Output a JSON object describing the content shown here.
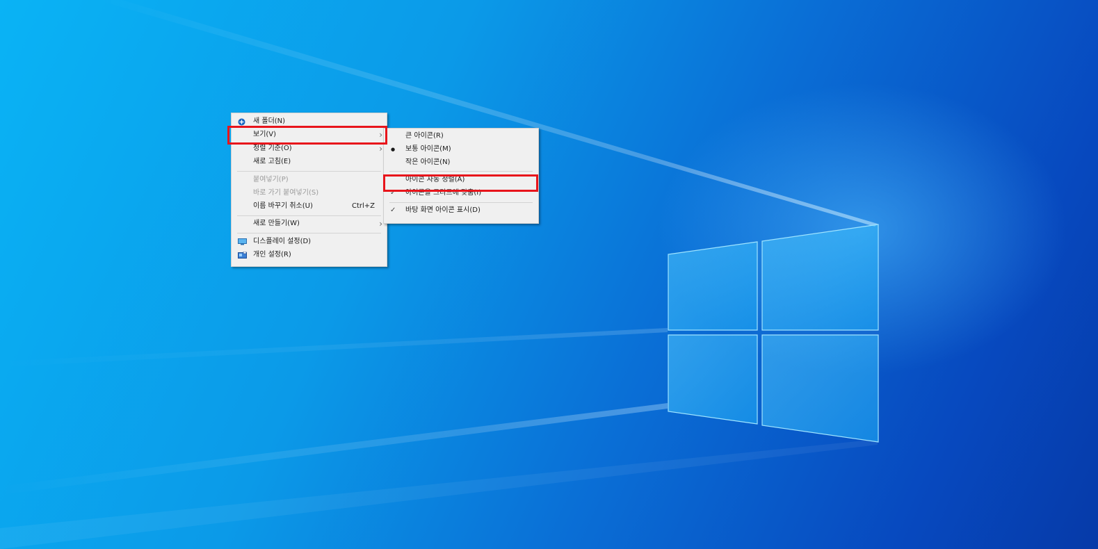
{
  "desktop": {
    "wallpaper": "Windows 10 hero wallpaper",
    "colors": {
      "highlight": "#e8141b",
      "menu_bg": "#f0f0f0",
      "accent_blue": "#0b9ae8"
    }
  },
  "context_menu": {
    "new_folder": "새 폴더(N)",
    "view": "보기(V)",
    "sort_by": "정렬 기준(O)",
    "refresh": "새로 고침(E)",
    "paste": "붙여넣기(P)",
    "paste_shortcut": "바로 가기 붙여넣기(S)",
    "undo_rename": "이름 바꾸기 취소(U)",
    "undo_rename_shortcut": "Ctrl+Z",
    "new": "새로 만들기(W)",
    "display_settings": "디스플레이 설정(D)",
    "personalize": "개인 설정(R)"
  },
  "view_submenu": {
    "large_icons": "큰 아이콘(R)",
    "medium_icons": "보통 아이콘(M)",
    "small_icons": "작은 아이콘(N)",
    "auto_arrange": "아이콘 자동 정렬(A)",
    "align_to_grid": "아이콘을 그리드에 맞춤(I)",
    "show_desktop_icons": "바탕 화면 아이콘 표시(D)",
    "bullet": "●",
    "check": "✓"
  },
  "icons": {
    "arrow": "›",
    "new_folder_icon": "plus-circle-icon",
    "display_icon": "monitor-icon",
    "personalize_icon": "personalize-icon"
  }
}
